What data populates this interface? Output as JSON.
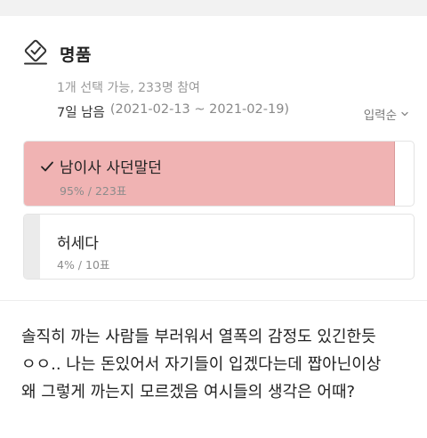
{
  "poll": {
    "title": "명품",
    "icon": "vote-icon",
    "meta": "1개 선택 가능, 233명 참여",
    "deadline_remaining": "7일 남음",
    "deadline_range": "(2021-02-13 ~ 2021-02-19)",
    "sort_label": "입력순",
    "options": [
      {
        "label": "남이사 사던말던",
        "stat": "95% / 223표",
        "percent": 95,
        "votes": 223,
        "selected": true,
        "fill_color": "#f0b3b3"
      },
      {
        "label": "허세다",
        "stat": "4% / 10표",
        "percent": 4,
        "votes": 10,
        "selected": false,
        "fill_color": "#ebebeb"
      }
    ]
  },
  "post": {
    "lines": [
      "솔직히 까는 사람들 부러워서 열폭의 감정도 있긴한듯",
      "ㅇㅇ.. 나는 돈있어서 자기들이 입겠다는데 짭아닌이상",
      "왜 그렇게 까는지 모르겠음 여시들의 생각은 어때?"
    ]
  }
}
